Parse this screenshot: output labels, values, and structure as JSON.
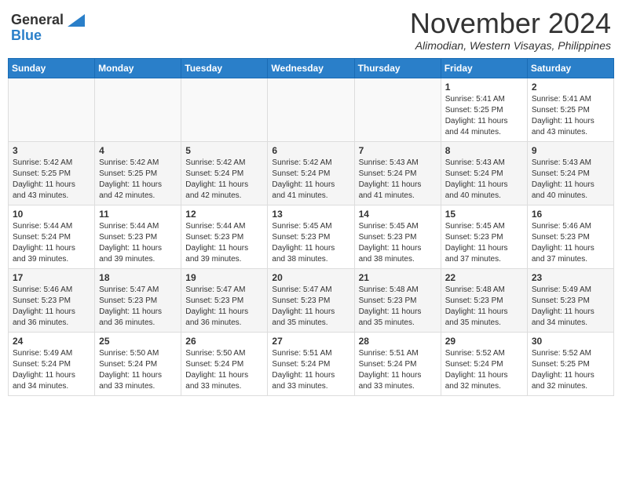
{
  "header": {
    "logo_general": "General",
    "logo_blue": "Blue",
    "month_title": "November 2024",
    "location": "Alimodian, Western Visayas, Philippines"
  },
  "weekdays": [
    "Sunday",
    "Monday",
    "Tuesday",
    "Wednesday",
    "Thursday",
    "Friday",
    "Saturday"
  ],
  "weeks": [
    [
      {
        "day": "",
        "info": ""
      },
      {
        "day": "",
        "info": ""
      },
      {
        "day": "",
        "info": ""
      },
      {
        "day": "",
        "info": ""
      },
      {
        "day": "",
        "info": ""
      },
      {
        "day": "1",
        "info": "Sunrise: 5:41 AM\nSunset: 5:25 PM\nDaylight: 11 hours\nand 44 minutes."
      },
      {
        "day": "2",
        "info": "Sunrise: 5:41 AM\nSunset: 5:25 PM\nDaylight: 11 hours\nand 43 minutes."
      }
    ],
    [
      {
        "day": "3",
        "info": "Sunrise: 5:42 AM\nSunset: 5:25 PM\nDaylight: 11 hours\nand 43 minutes."
      },
      {
        "day": "4",
        "info": "Sunrise: 5:42 AM\nSunset: 5:25 PM\nDaylight: 11 hours\nand 42 minutes."
      },
      {
        "day": "5",
        "info": "Sunrise: 5:42 AM\nSunset: 5:24 PM\nDaylight: 11 hours\nand 42 minutes."
      },
      {
        "day": "6",
        "info": "Sunrise: 5:42 AM\nSunset: 5:24 PM\nDaylight: 11 hours\nand 41 minutes."
      },
      {
        "day": "7",
        "info": "Sunrise: 5:43 AM\nSunset: 5:24 PM\nDaylight: 11 hours\nand 41 minutes."
      },
      {
        "day": "8",
        "info": "Sunrise: 5:43 AM\nSunset: 5:24 PM\nDaylight: 11 hours\nand 40 minutes."
      },
      {
        "day": "9",
        "info": "Sunrise: 5:43 AM\nSunset: 5:24 PM\nDaylight: 11 hours\nand 40 minutes."
      }
    ],
    [
      {
        "day": "10",
        "info": "Sunrise: 5:44 AM\nSunset: 5:24 PM\nDaylight: 11 hours\nand 39 minutes."
      },
      {
        "day": "11",
        "info": "Sunrise: 5:44 AM\nSunset: 5:23 PM\nDaylight: 11 hours\nand 39 minutes."
      },
      {
        "day": "12",
        "info": "Sunrise: 5:44 AM\nSunset: 5:23 PM\nDaylight: 11 hours\nand 39 minutes."
      },
      {
        "day": "13",
        "info": "Sunrise: 5:45 AM\nSunset: 5:23 PM\nDaylight: 11 hours\nand 38 minutes."
      },
      {
        "day": "14",
        "info": "Sunrise: 5:45 AM\nSunset: 5:23 PM\nDaylight: 11 hours\nand 38 minutes."
      },
      {
        "day": "15",
        "info": "Sunrise: 5:45 AM\nSunset: 5:23 PM\nDaylight: 11 hours\nand 37 minutes."
      },
      {
        "day": "16",
        "info": "Sunrise: 5:46 AM\nSunset: 5:23 PM\nDaylight: 11 hours\nand 37 minutes."
      }
    ],
    [
      {
        "day": "17",
        "info": "Sunrise: 5:46 AM\nSunset: 5:23 PM\nDaylight: 11 hours\nand 36 minutes."
      },
      {
        "day": "18",
        "info": "Sunrise: 5:47 AM\nSunset: 5:23 PM\nDaylight: 11 hours\nand 36 minutes."
      },
      {
        "day": "19",
        "info": "Sunrise: 5:47 AM\nSunset: 5:23 PM\nDaylight: 11 hours\nand 36 minutes."
      },
      {
        "day": "20",
        "info": "Sunrise: 5:47 AM\nSunset: 5:23 PM\nDaylight: 11 hours\nand 35 minutes."
      },
      {
        "day": "21",
        "info": "Sunrise: 5:48 AM\nSunset: 5:23 PM\nDaylight: 11 hours\nand 35 minutes."
      },
      {
        "day": "22",
        "info": "Sunrise: 5:48 AM\nSunset: 5:23 PM\nDaylight: 11 hours\nand 35 minutes."
      },
      {
        "day": "23",
        "info": "Sunrise: 5:49 AM\nSunset: 5:23 PM\nDaylight: 11 hours\nand 34 minutes."
      }
    ],
    [
      {
        "day": "24",
        "info": "Sunrise: 5:49 AM\nSunset: 5:24 PM\nDaylight: 11 hours\nand 34 minutes."
      },
      {
        "day": "25",
        "info": "Sunrise: 5:50 AM\nSunset: 5:24 PM\nDaylight: 11 hours\nand 33 minutes."
      },
      {
        "day": "26",
        "info": "Sunrise: 5:50 AM\nSunset: 5:24 PM\nDaylight: 11 hours\nand 33 minutes."
      },
      {
        "day": "27",
        "info": "Sunrise: 5:51 AM\nSunset: 5:24 PM\nDaylight: 11 hours\nand 33 minutes."
      },
      {
        "day": "28",
        "info": "Sunrise: 5:51 AM\nSunset: 5:24 PM\nDaylight: 11 hours\nand 33 minutes."
      },
      {
        "day": "29",
        "info": "Sunrise: 5:52 AM\nSunset: 5:24 PM\nDaylight: 11 hours\nand 32 minutes."
      },
      {
        "day": "30",
        "info": "Sunrise: 5:52 AM\nSunset: 5:25 PM\nDaylight: 11 hours\nand 32 minutes."
      }
    ]
  ]
}
